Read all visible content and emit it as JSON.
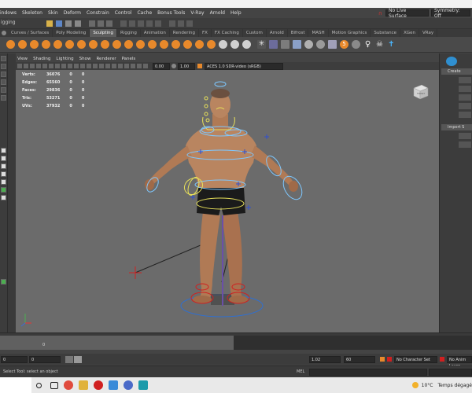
{
  "menu": {
    "items": [
      "indows",
      "Skeleton",
      "Skin",
      "Deform",
      "Constrain",
      "Control",
      "Cache",
      "Bonus Tools",
      "V-Ray",
      "Arnold",
      "Help"
    ],
    "live_surface": "No Live Surface",
    "symmetry": "Symmetry: Off",
    "menuset": "igging"
  },
  "shelf_tabs": [
    "Curves / Surfaces",
    "Poly Modeling",
    "Sculpting",
    "Rigging",
    "Animation",
    "Rendering",
    "FX",
    "FX Caching",
    "Custom",
    "Arnold",
    "Bifrost",
    "MASH",
    "Motion Graphics",
    "Substance",
    "XGen",
    "VRay"
  ],
  "shelf_active": "Sculpting",
  "viewport_menu": [
    "View",
    "Shading",
    "Lighting",
    "Show",
    "Renderer",
    "Panels"
  ],
  "viewport_toolbar": {
    "value_a": "0.00",
    "value_b": "1.00",
    "colorspace": "ACES 1.0 SDR-video (sRGB)"
  },
  "stats": [
    {
      "label": "Verts:",
      "a": "36076",
      "b": "0",
      "c": "0"
    },
    {
      "label": "Edges:",
      "a": "65560",
      "b": "0",
      "c": "0"
    },
    {
      "label": "Faces:",
      "a": "29836",
      "b": "0",
      "c": "0"
    },
    {
      "label": "Tris:",
      "a": "53271",
      "b": "0",
      "c": "0"
    },
    {
      "label": "UVs:",
      "a": "37932",
      "b": "0",
      "c": "0"
    }
  ],
  "viewcube_label": "FRONT",
  "right_panel": {
    "create_label": "Create",
    "import_label": "Import S"
  },
  "timeline": {
    "current_frame": "0"
  },
  "range": {
    "start": "0",
    "start2": "0",
    "end": "1.02",
    "end2": "60",
    "character_set": "No Character Set",
    "anim_layer": "No Anim Layer"
  },
  "helpline": {
    "text": "Select Tool: select an object",
    "mel": "MEL"
  },
  "taskbar": {
    "weather": "10°C",
    "weather_text": "Temps dégagé"
  },
  "colors": {
    "accent_orange": "#e8892b",
    "rig_yellow": "#e7e05a",
    "rig_blue": "#2f6fd0",
    "rig_red": "#d02020"
  }
}
